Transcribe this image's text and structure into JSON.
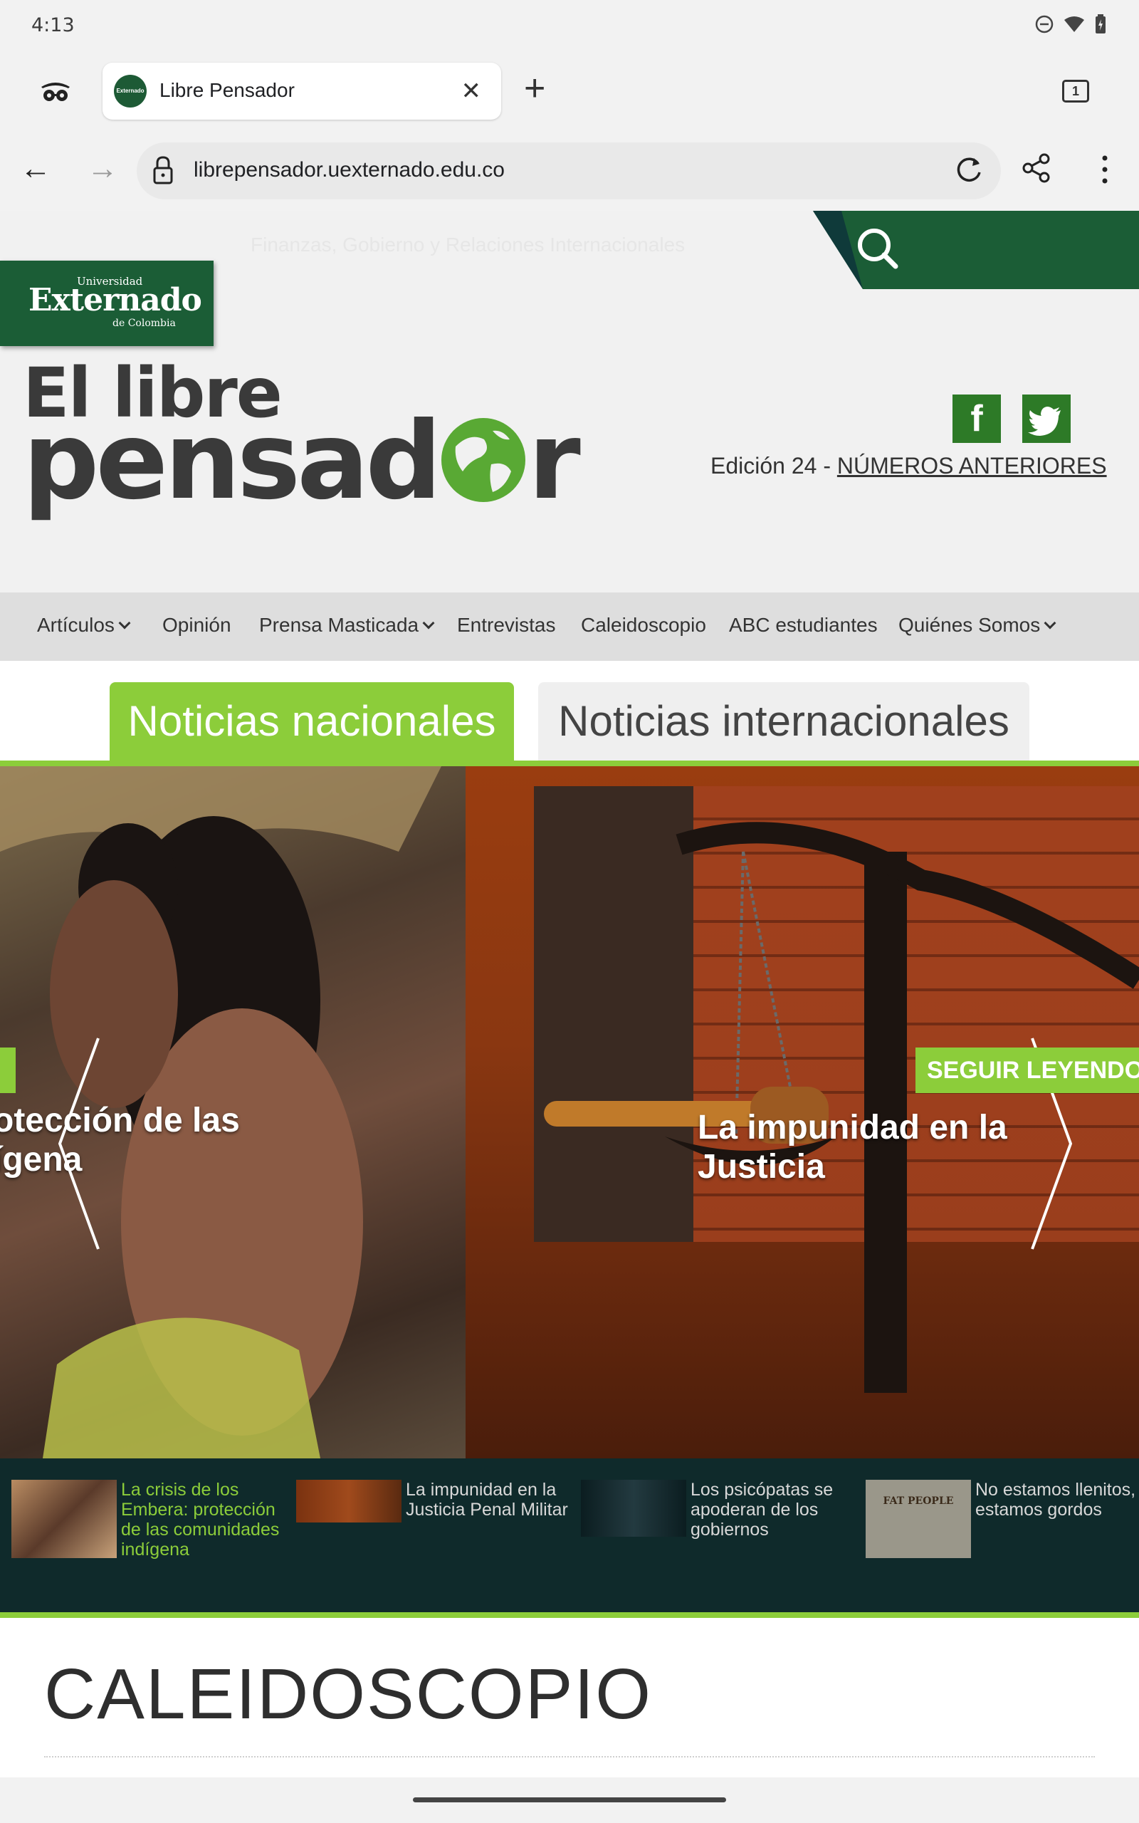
{
  "status": {
    "time": "4:13"
  },
  "browser": {
    "tab_title": "Libre Pensador",
    "tab_count": "1",
    "url": "librepensador.uexternado.edu.co"
  },
  "site": {
    "tagline": "Finanzas, Gobierno y Relaciones Internacionales",
    "university": {
      "top": "Universidad",
      "name": "Externado",
      "bottom": "de Colombia"
    },
    "brand_line1": "El libre",
    "brand_line2a": "pensad",
    "brand_line2b": "r",
    "edition_prefix": "Edición 24 - ",
    "edition_link": "NÚMEROS ANTERIORES",
    "social": {
      "facebook": "f"
    },
    "nav": [
      {
        "label": "Artículos",
        "dropdown": true
      },
      {
        "label": "Opinión"
      },
      {
        "label": "Prensa Masticada",
        "dropdown": true
      },
      {
        "label": "Entrevistas"
      },
      {
        "label": "Caleidoscopio"
      },
      {
        "label": "ABC estudiantes"
      },
      {
        "label": "Quiénes Somos",
        "dropdown": true
      }
    ],
    "news_tabs": {
      "national": "Noticias nacionales",
      "international": "Noticias internacionales"
    },
    "slides": {
      "left_caption_1": "otección de las",
      "left_caption_2": "ígena",
      "right_caption": "La impunidad en la Justicia",
      "read_more": "SEGUIR LEYENDO"
    },
    "thumbs": [
      {
        "text": "La crisis de los Embera: protección de las comunidades indígena",
        "active": true
      },
      {
        "text": "La impunidad en la Justicia Penal Militar"
      },
      {
        "text": "Los psicópatas se apoderan de los gobiernos"
      },
      {
        "text": "No estamos llenitos, estamos gordos",
        "img_text": "FAT PEOPLE"
      }
    ],
    "section_title": "CALEIDOSCOPIO"
  },
  "colors": {
    "brand_green": "#1b5d36",
    "accent_green": "#8ccd3a",
    "thumb_bg": "#0f2a2b"
  }
}
